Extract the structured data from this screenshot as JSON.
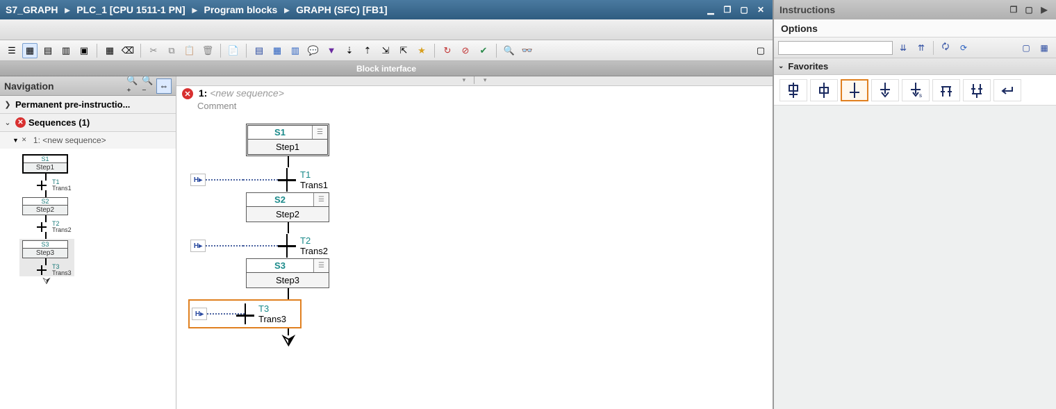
{
  "titlebar": {
    "crumbs": [
      "S7_GRAPH",
      "PLC_1 [CPU 1511-1 PN]",
      "Program blocks",
      "GRAPH (SFC) [FB1]"
    ]
  },
  "block_interface_label": "Block interface",
  "navigation": {
    "title": "Navigation",
    "pre_instructions_label": "Permanent pre-instructio...",
    "sequences_label": "Sequences (1)",
    "seq_item": "1: <new sequence>",
    "mini": {
      "steps": [
        {
          "num": "S1",
          "name": "Step1"
        },
        {
          "num": "S2",
          "name": "Step2"
        },
        {
          "num": "S3",
          "name": "Step3"
        }
      ],
      "trans": [
        {
          "num": "T1",
          "name": "Trans1"
        },
        {
          "num": "T2",
          "name": "Trans2"
        },
        {
          "num": "T3",
          "name": "Trans3"
        }
      ]
    }
  },
  "canvas": {
    "seq_num": "1:",
    "seq_placeholder": "<new sequence>",
    "comment": "Comment",
    "steps": [
      {
        "num": "S1",
        "name": "Step1"
      },
      {
        "num": "S2",
        "name": "Step2"
      },
      {
        "num": "S3",
        "name": "Step3"
      }
    ],
    "trans": [
      {
        "num": "T1",
        "name": "Trans1"
      },
      {
        "num": "T2",
        "name": "Trans2"
      },
      {
        "num": "T3",
        "name": "Trans3"
      }
    ]
  },
  "instructions": {
    "title": "Instructions",
    "options_label": "Options",
    "favorites_label": "Favorites",
    "search_placeholder": ""
  }
}
